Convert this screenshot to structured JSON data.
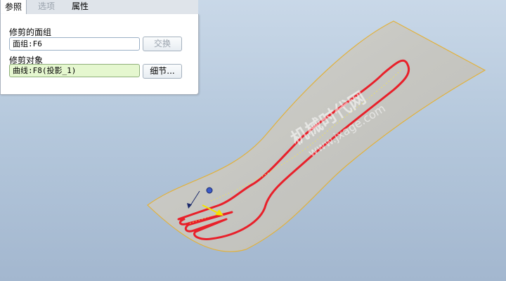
{
  "tabs": [
    {
      "label": "参照",
      "active": true
    },
    {
      "label": "选项",
      "active": false
    },
    {
      "label": "属性",
      "active": false
    }
  ],
  "panel": {
    "surface_label": "修剪的面组",
    "surface_value": "面组:F6",
    "swap_button": "交换",
    "trim_label": "修剪对象",
    "trim_value": "曲线:F8(投影_1)",
    "details_button": "细节..."
  },
  "watermark": {
    "line1": "机械时代网",
    "line2": "www.jxage.com"
  },
  "colors": {
    "surface": "#c9c9c4",
    "surface_edge": "#e2b13a",
    "curve": "#e8202a",
    "arrow": "#f4e400",
    "viewport_top": "#c9d8e8",
    "viewport_bottom": "#a3b7cf"
  }
}
